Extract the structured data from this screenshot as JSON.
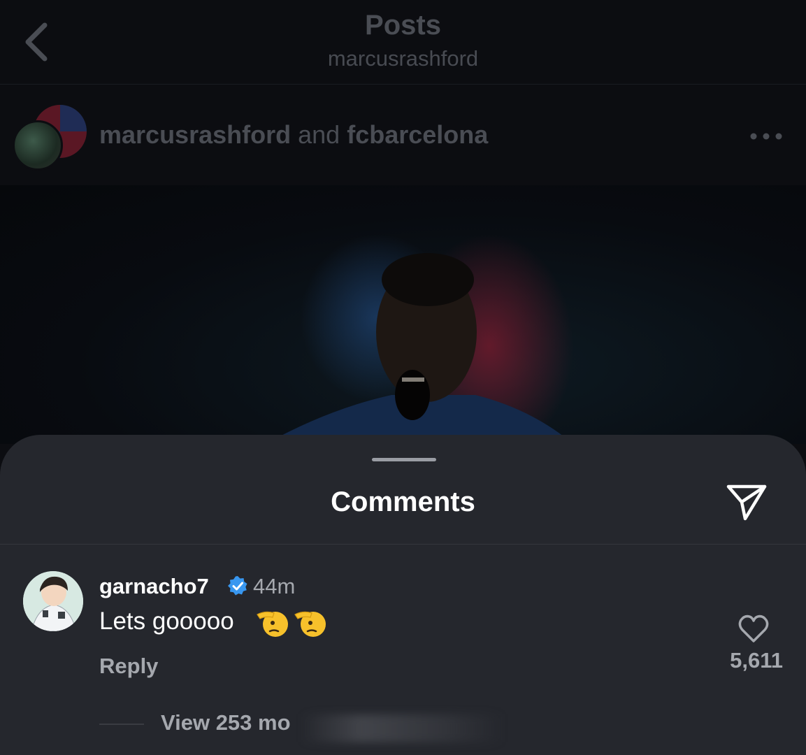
{
  "header": {
    "title": "Posts",
    "subtitle": "marcusrashford",
    "back_icon": "chevron-left-icon"
  },
  "post": {
    "author": "marcusrashford",
    "connector": "and",
    "collaborator": "fcbarcelona",
    "more_icon": "more-horizontal-icon"
  },
  "comments_sheet": {
    "title": "Comments",
    "share_icon": "paper-plane-icon",
    "comment": {
      "username": "garnacho7",
      "verified_icon": "verified-badge-icon",
      "time": "44m",
      "text": "Lets gooooo",
      "emojis": [
        "saluting-face-emoji",
        "saluting-face-emoji"
      ],
      "reply_label": "Reply",
      "like_icon": "heart-outline-icon",
      "like_count": "5,611"
    },
    "view_more_label": "View 253 mo"
  },
  "colors": {
    "background": "#0c0d11",
    "sheet": "#25272d",
    "secondary_text": "#a5a8ae",
    "verified_blue": "#3897f0"
  }
}
